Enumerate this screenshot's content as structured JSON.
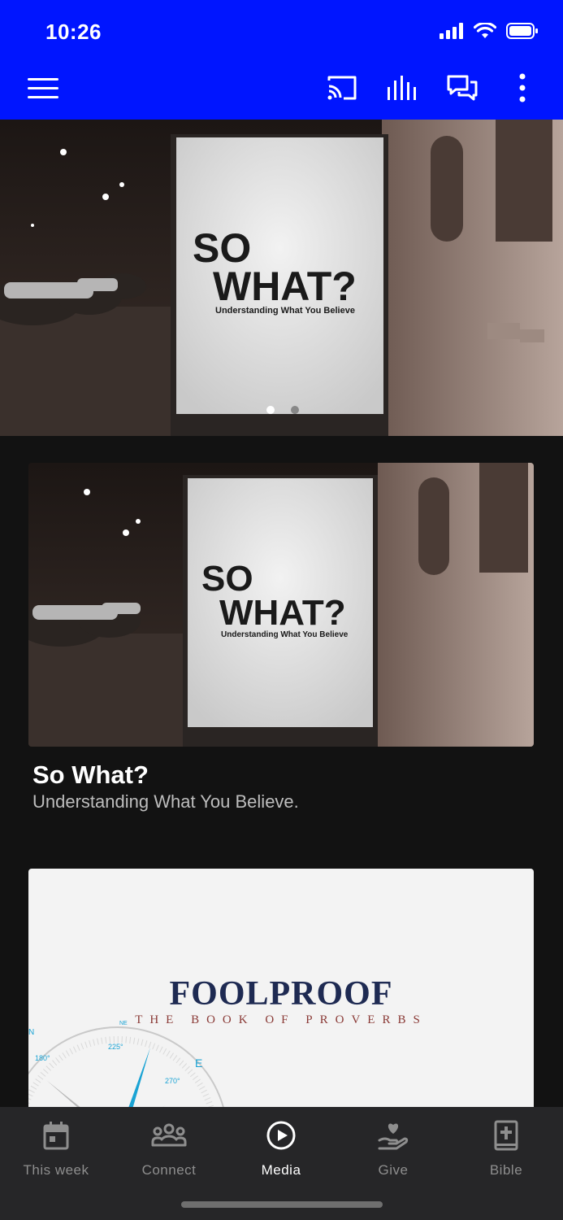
{
  "status_bar": {
    "time": "10:26"
  },
  "appbar": {
    "icons": [
      "menu-icon",
      "cast-icon",
      "audio-bars-icon",
      "chat-icon",
      "more-vertical-icon"
    ],
    "accent_color": "#0015ff"
  },
  "hero": {
    "poster": {
      "line1": "SO",
      "line2": "WHAT?",
      "tagline": "Understanding What You Believe"
    },
    "carousel": {
      "page_count": 2,
      "active_index": 0
    }
  },
  "cards": [
    {
      "poster": {
        "line1": "SO",
        "line2": "WHAT?",
        "tagline": "Understanding What You Believe"
      },
      "title": "So What?",
      "subtitle": "Understanding What You Believe."
    },
    {
      "poster": {
        "title": "FOOLPROOF",
        "subtitle": "THE BOOK OF PROVERBS",
        "compass_labels": [
          "180°",
          "225°",
          "270°",
          "NE",
          "E",
          "N"
        ]
      }
    }
  ],
  "bottom_nav": {
    "items": [
      {
        "label": "This week",
        "icon": "calendar-icon",
        "active": false
      },
      {
        "label": "Connect",
        "icon": "people-group-icon",
        "active": false
      },
      {
        "label": "Media",
        "icon": "play-circle-icon",
        "active": true
      },
      {
        "label": "Give",
        "icon": "heart-hand-icon",
        "active": false
      },
      {
        "label": "Bible",
        "icon": "bible-icon",
        "active": false
      }
    ]
  }
}
